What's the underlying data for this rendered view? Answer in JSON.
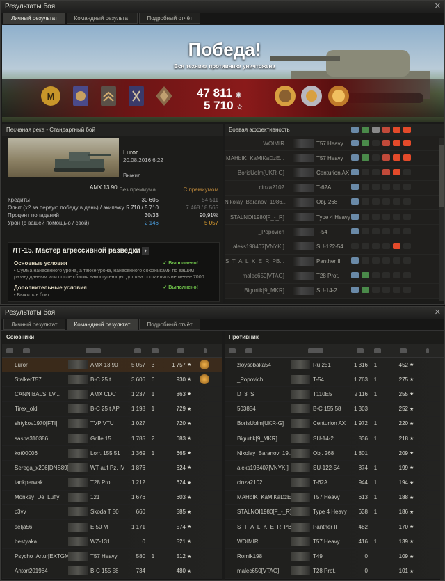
{
  "win1": {
    "title": "Результаты боя",
    "tabs": [
      "Личный результат",
      "Командный результат",
      "Подробный отчёт"
    ],
    "banner": {
      "victory": "Победа!",
      "subtitle": "Вся техника противника уничтожена",
      "credits": "47 811",
      "xp": "5 710",
      "credits_icon": "credits-icon",
      "xp_icon": "star-icon"
    },
    "left": {
      "header": "Песчаная река - Стандартный бой",
      "tank": "AMX 13 90",
      "player": "Luror",
      "date": "20.08.2016 6:22",
      "status": "Выжил",
      "col1": "Без премиума",
      "col2": "С премиумом",
      "stats": [
        {
          "label": "Кредиты",
          "v1": "30 605",
          "v2": "54 511"
        },
        {
          "label": "Опыт  (x2 за первую победу в день) / экипажу",
          "v1": "5 710 / 5 710",
          "v2": "7 468 / 8 565"
        },
        {
          "label": "Процент попаданий",
          "v1": "30/33",
          "v2": "90,91%"
        },
        {
          "label": "Урон (с вашей помощью / свой)",
          "v1": "2 146",
          "v2": "5 057"
        }
      ],
      "mission": {
        "title": "ЛТ-15. Мастер агрессивной разведки",
        "main": "Основные условия",
        "main_done": "✓ Выполнено!",
        "main_text": "• Сумма нанесённого урона, а также урона, нанесённого союзниками по вашим разведданным или после сбития вами гусеницы, должна составлять не менее 7000.",
        "extra": "Дополнительные условия",
        "extra_done": "✓ Выполнено!",
        "extra_text": "• Выжить в бою."
      }
    },
    "right": {
      "header": "Боевая эффективность",
      "rows": [
        {
          "name": "WOIMIR",
          "veh": "T57 Heavy"
        },
        {
          "name": "MAHbIK_KaMiKaDzE...",
          "veh": "T57 Heavy"
        },
        {
          "name": "BorisUolm[UKR-G]",
          "veh": "Centurion AX"
        },
        {
          "name": "cinza2102",
          "veh": "T-62A"
        },
        {
          "name": "Nikolay_Baranov_1986...",
          "veh": "Obj. 268"
        },
        {
          "name": "STALNOI1980[F_-_R]",
          "veh": "Type 4 Heavy"
        },
        {
          "name": "_Popovich",
          "veh": "T-54"
        },
        {
          "name": "aleks198407[VNYKI]",
          "veh": "SU-122-54"
        },
        {
          "name": "S_T_A_L_K_E_R_PB...",
          "veh": "Panther II"
        },
        {
          "name": "malec650[VTAG]",
          "veh": "T28 Prot."
        },
        {
          "name": "Bigurtik[9_MKR]",
          "veh": "SU-14-2"
        }
      ]
    }
  },
  "win2": {
    "title": "Результаты боя",
    "tabs": [
      "Личный результат",
      "Командный результат",
      "Подробный отчёт"
    ],
    "allies_title": "Союзники",
    "enemies_title": "Противник",
    "allies": [
      {
        "name": "Luror",
        "veh": "AMX 13 90",
        "dmg": "5 057",
        "kills": "3",
        "xp": "1 757"
      },
      {
        "name": "StalkerT57",
        "veh": "B-C 25 t",
        "dmg": "3 606",
        "kills": "6",
        "xp": "930"
      },
      {
        "name": "CANNIBALS_LV...",
        "veh": "AMX CDC",
        "dmg": "1 237",
        "kills": "1",
        "xp": "863"
      },
      {
        "name": "Tirex_old",
        "veh": "B-C 25 t AP",
        "dmg": "1 198",
        "kills": "1",
        "xp": "729"
      },
      {
        "name": "shtykov1970[FTI]",
        "veh": "TVP VTU",
        "dmg": "1 027",
        "kills": "",
        "xp": "720"
      },
      {
        "name": "sasha310386",
        "veh": "Grille 15",
        "dmg": "1 785",
        "kills": "2",
        "xp": "683"
      },
      {
        "name": "kot00006",
        "veh": "Lorr. 155 51",
        "dmg": "1 369",
        "kills": "1",
        "xp": "665"
      },
      {
        "name": "Serega_x206[DNS89]",
        "veh": "WT auf Pz. IV",
        "dmg": "1 876",
        "kills": "",
        "xp": "624"
      },
      {
        "name": "tankperwak",
        "veh": "T28 Prot.",
        "dmg": "1 212",
        "kills": "",
        "xp": "624"
      },
      {
        "name": "Monkey_De_Luffy",
        "veh": "121",
        "dmg": "1 676",
        "kills": "",
        "xp": "603"
      },
      {
        "name": "c3vv",
        "veh": "Skoda T 50",
        "dmg": "660",
        "kills": "",
        "xp": "585"
      },
      {
        "name": "selja56",
        "veh": "E 50 M",
        "dmg": "1 171",
        "kills": "",
        "xp": "574"
      },
      {
        "name": "bestyaka",
        "veh": "WZ-131",
        "dmg": "0",
        "kills": "",
        "xp": "521"
      },
      {
        "name": "Psycho_Artur[EXTGM]",
        "veh": "T57 Heavy",
        "dmg": "580",
        "kills": "1",
        "xp": "512"
      },
      {
        "name": "Anton201984",
        "veh": "B-C 155 58",
        "dmg": "734",
        "kills": "",
        "xp": "480"
      }
    ],
    "enemies": [
      {
        "name": "zloysobaka54",
        "veh": "Ru 251",
        "dmg": "1 316",
        "kills": "1",
        "xp": "452"
      },
      {
        "name": "_Popovich",
        "veh": "T-54",
        "dmg": "1 763",
        "kills": "1",
        "xp": "275"
      },
      {
        "name": "D_3_S",
        "veh": "T110E5",
        "dmg": "2 116",
        "kills": "1",
        "xp": "255"
      },
      {
        "name": "503854",
        "veh": "B-C 155 58",
        "dmg": "1 303",
        "kills": "",
        "xp": "252"
      },
      {
        "name": "BorisUolm[UKR-G]",
        "veh": "Centurion AX",
        "dmg": "1 972",
        "kills": "1",
        "xp": "220"
      },
      {
        "name": "Bigurtik[9_MKR]",
        "veh": "SU-14-2",
        "dmg": "836",
        "kills": "1",
        "xp": "218"
      },
      {
        "name": "Nikolay_Baranov_19...",
        "veh": "Obj. 268",
        "dmg": "1 801",
        "kills": "",
        "xp": "209"
      },
      {
        "name": "aleks198407[VNYKI]",
        "veh": "SU-122-54",
        "dmg": "874",
        "kills": "1",
        "xp": "199"
      },
      {
        "name": "cinza2102",
        "veh": "T-62A",
        "dmg": "944",
        "kills": "1",
        "xp": "194"
      },
      {
        "name": "MAHbIK_KaMiKaDzE...",
        "veh": "T57 Heavy",
        "dmg": "613",
        "kills": "1",
        "xp": "188"
      },
      {
        "name": "STALNOI1980[F_-_R]",
        "veh": "Type 4 Heavy",
        "dmg": "638",
        "kills": "1",
        "xp": "186"
      },
      {
        "name": "S_T_A_L_K_E_R_PB...",
        "veh": "Panther II",
        "dmg": "482",
        "kills": "",
        "xp": "170"
      },
      {
        "name": "WOIMIR",
        "veh": "T57 Heavy",
        "dmg": "416",
        "kills": "1",
        "xp": "139"
      },
      {
        "name": "Romik198",
        "veh": "T49",
        "dmg": "0",
        "kills": "",
        "xp": "109"
      },
      {
        "name": "malec650[VTAG]",
        "veh": "T28 Prot.",
        "dmg": "0",
        "kills": "",
        "xp": "101"
      }
    ]
  }
}
